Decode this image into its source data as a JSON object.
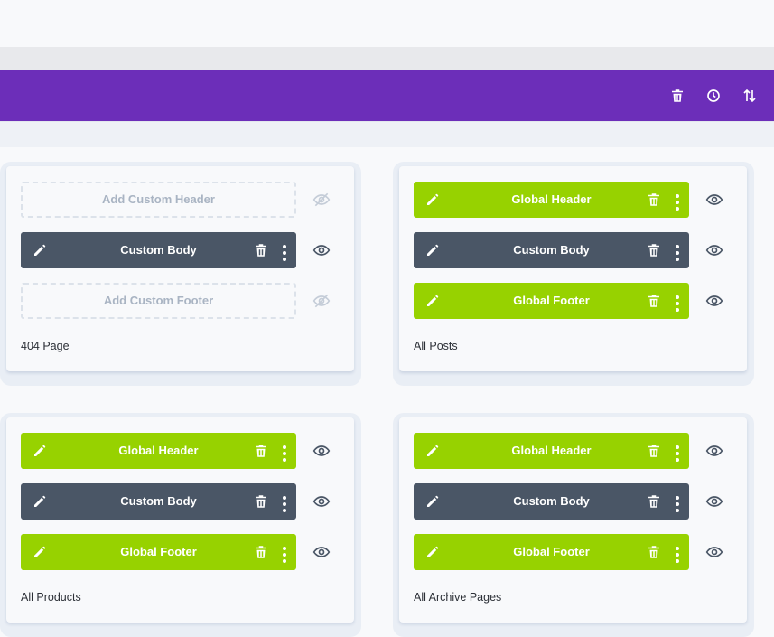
{
  "toolbar": {
    "icons": [
      "trash-icon",
      "history-icon",
      "sort-icon"
    ]
  },
  "cards": [
    {
      "title": "404 Page",
      "rows": [
        {
          "type": "empty",
          "label": "Add Custom Header",
          "visibility": "hidden"
        },
        {
          "type": "dark",
          "label": "Custom Body",
          "visibility": "visible"
        },
        {
          "type": "empty",
          "label": "Add Custom Footer",
          "visibility": "hidden"
        }
      ]
    },
    {
      "title": "All Posts",
      "rows": [
        {
          "type": "green",
          "label": "Global Header",
          "visibility": "visible"
        },
        {
          "type": "dark",
          "label": "Custom Body",
          "visibility": "visible"
        },
        {
          "type": "green",
          "label": "Global Footer",
          "visibility": "visible"
        }
      ]
    },
    {
      "title": "All Products",
      "rows": [
        {
          "type": "green",
          "label": "Global Header",
          "visibility": "visible"
        },
        {
          "type": "dark",
          "label": "Custom Body",
          "visibility": "visible"
        },
        {
          "type": "green",
          "label": "Global Footer",
          "visibility": "visible"
        }
      ]
    },
    {
      "title": "All Archive Pages",
      "rows": [
        {
          "type": "green",
          "label": "Global Header",
          "visibility": "visible"
        },
        {
          "type": "dark",
          "label": "Custom Body",
          "visibility": "visible"
        },
        {
          "type": "green",
          "label": "Global Footer",
          "visibility": "visible"
        }
      ]
    }
  ],
  "colors": {
    "purple": "#6c2eb9",
    "green": "#97d200",
    "dark": "#4a5666"
  }
}
